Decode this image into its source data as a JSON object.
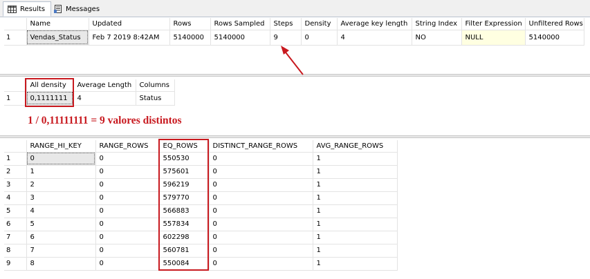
{
  "tabs": [
    {
      "label": "Results",
      "icon": "grid-icon"
    },
    {
      "label": "Messages",
      "icon": "messages-icon"
    }
  ],
  "header_grid": {
    "columns": [
      "Name",
      "Updated",
      "Rows",
      "Rows Sampled",
      "Steps",
      "Density",
      "Average key length",
      "String Index",
      "Filter Expression",
      "Unfiltered Rows"
    ],
    "rows": [
      {
        "num": "1",
        "cells": [
          "Vendas_Status",
          "Feb  7 2019  8:42AM",
          "5140000",
          "5140000",
          "9",
          "0",
          "4",
          "NO",
          "NULL",
          "5140000"
        ]
      }
    ]
  },
  "density_grid": {
    "columns": [
      "All density",
      "Average Length",
      "Columns"
    ],
    "rows": [
      {
        "num": "1",
        "cells": [
          "0,1111111",
          "4",
          "Status"
        ]
      }
    ]
  },
  "annotation_text": "1 / 0,11111111 = 9 valores distintos",
  "histogram_grid": {
    "columns": [
      "RANGE_HI_KEY",
      "RANGE_ROWS",
      "EQ_ROWS",
      "DISTINCT_RANGE_ROWS",
      "AVG_RANGE_ROWS"
    ],
    "rows": [
      {
        "num": "1",
        "cells": [
          "0",
          "0",
          "550530",
          "0",
          "1"
        ]
      },
      {
        "num": "2",
        "cells": [
          "1",
          "0",
          "575601",
          "0",
          "1"
        ]
      },
      {
        "num": "3",
        "cells": [
          "2",
          "0",
          "596219",
          "0",
          "1"
        ]
      },
      {
        "num": "4",
        "cells": [
          "3",
          "0",
          "579770",
          "0",
          "1"
        ]
      },
      {
        "num": "5",
        "cells": [
          "4",
          "0",
          "566883",
          "0",
          "1"
        ]
      },
      {
        "num": "6",
        "cells": [
          "5",
          "0",
          "557834",
          "0",
          "1"
        ]
      },
      {
        "num": "7",
        "cells": [
          "6",
          "0",
          "602298",
          "0",
          "1"
        ]
      },
      {
        "num": "8",
        "cells": [
          "7",
          "0",
          "560781",
          "0",
          "1"
        ]
      },
      {
        "num": "9",
        "cells": [
          "8",
          "0",
          "550084",
          "0",
          "1"
        ]
      }
    ]
  },
  "colors": {
    "highlight_red": "#c8191f",
    "null_cell": "#ffffe1"
  }
}
